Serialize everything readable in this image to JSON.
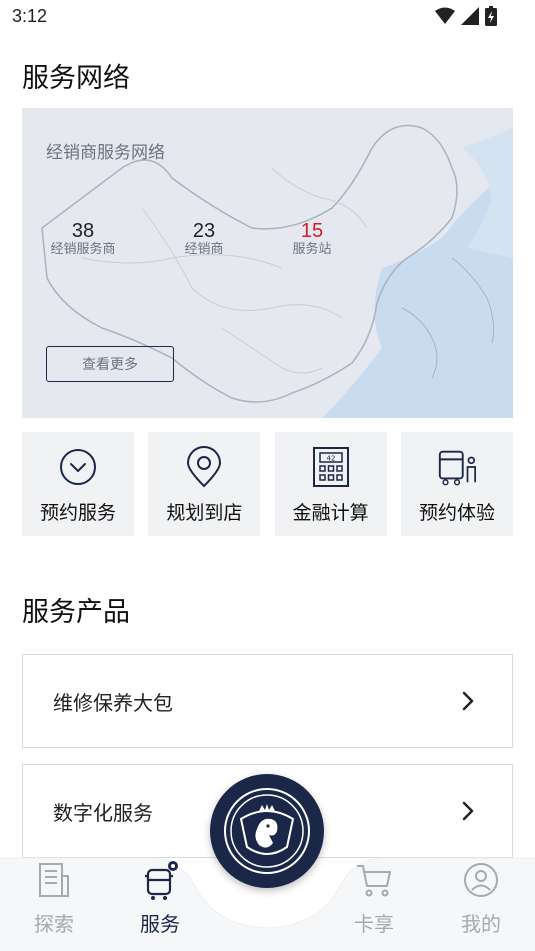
{
  "status_bar": {
    "time": "3:12"
  },
  "network": {
    "title": "服务网络",
    "map_label": "经销商服务网络",
    "stats": [
      {
        "value": "38",
        "label": "经销服务商"
      },
      {
        "value": "23",
        "label": "经销商"
      },
      {
        "value": "15",
        "label": "服务站"
      }
    ],
    "more_label": "查看更多"
  },
  "quick_actions": [
    {
      "label": "预约服务",
      "icon": "clock-icon"
    },
    {
      "label": "规划到店",
      "icon": "location-pin-icon"
    },
    {
      "label": "金融计算",
      "icon": "calculator-icon"
    },
    {
      "label": "预约体验",
      "icon": "bus-person-icon"
    }
  ],
  "products": {
    "title": "服务产品",
    "items": [
      {
        "label": "维修保养大包"
      },
      {
        "label": "数字化服务"
      }
    ]
  },
  "bottom_nav": {
    "items": [
      {
        "label": "探索",
        "icon": "document-icon"
      },
      {
        "label": "服务",
        "icon": "truck-icon"
      },
      {
        "label": "卡享",
        "icon": "cart-icon"
      },
      {
        "label": "我的",
        "icon": "profile-icon"
      }
    ],
    "active": "服务"
  },
  "colors": {
    "brand": "#1a2748",
    "accent_red": "#d21f2b",
    "map_bg": "#e3e8ef",
    "card_bg": "#f1f2f4"
  }
}
